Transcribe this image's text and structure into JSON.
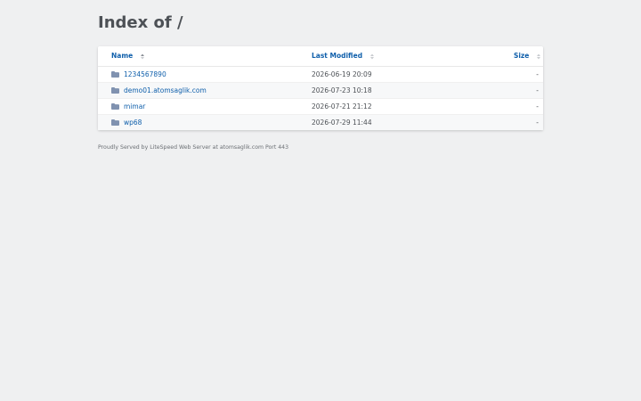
{
  "heading": "Index of /",
  "columns": {
    "name": "Name",
    "modified": "Last Modified",
    "size": "Size"
  },
  "rows": [
    {
      "name": "1234567890",
      "modified": "2026-06-19 20:09",
      "size": "-"
    },
    {
      "name": "demo01.atomsaglik.com",
      "modified": "2026-07-23 10:18",
      "size": "-"
    },
    {
      "name": "mimar",
      "modified": "2026-07-21 21:12",
      "size": "-"
    },
    {
      "name": "wp68",
      "modified": "2026-07-29 11:44",
      "size": "-"
    }
  ],
  "footer": "Proudly Served by LiteSpeed Web Server at atomsaglik.com Port 443",
  "colors": {
    "link": "#0f5fab",
    "text": "#4d5156",
    "background": "#eff0f1",
    "folder_icon": "#8092b0"
  }
}
